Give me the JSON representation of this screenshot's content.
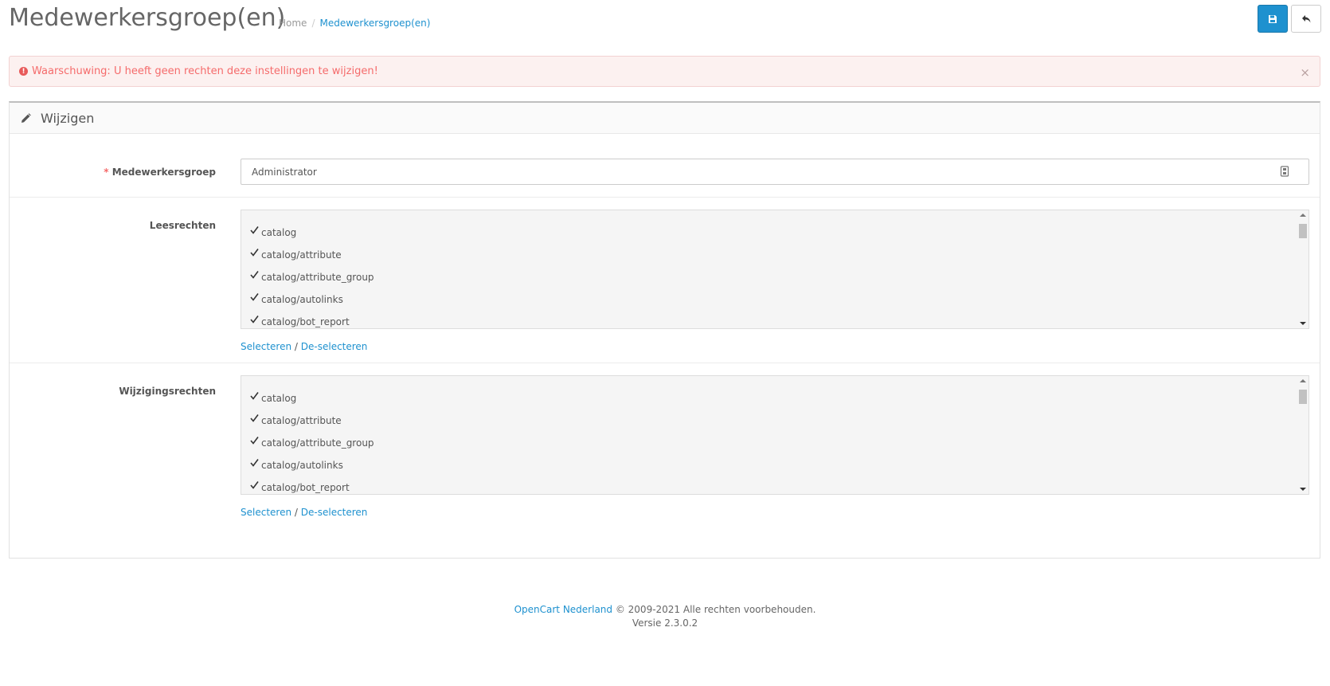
{
  "header": {
    "title": "Medewerkersgroep(en)",
    "breadcrumb": [
      "Home",
      "/",
      "Medewerkersgroep(en)"
    ],
    "save_icon": "floppy-disk-icon",
    "back_icon": "reply-arrow-icon"
  },
  "alert": {
    "text": "Waarschuwing: U heeft geen rechten deze instellingen te wijzigen!",
    "close": "×"
  },
  "panel": {
    "heading": "Wijzigen",
    "group_field": {
      "required_mark": "*",
      "label": "Medewerkersgroep",
      "value": "Administrator"
    },
    "read_access": {
      "label": "Leesrechten",
      "items": [
        "catalog",
        "catalog/attribute",
        "catalog/attribute_group",
        "catalog/autolinks",
        "catalog/bot_report"
      ],
      "select": "Selecteren",
      "divider": "/",
      "deselect": "De-selecteren"
    },
    "modify_access": {
      "label": "Wijzigingsrechten",
      "items": [
        "catalog",
        "catalog/attribute",
        "catalog/attribute_group",
        "catalog/autolinks",
        "catalog/bot_report"
      ],
      "select": "Selecteren",
      "divider": "/",
      "deselect": "De-selecteren"
    }
  },
  "footer": {
    "brand": "OpenCart Nederland",
    "copyright": " © 2009-2021 Alle rechten voorbehouden.",
    "version": "Versie 2.3.0.2"
  },
  "colors": {
    "primary": "#1e91cf",
    "danger": "#f56b6b"
  }
}
